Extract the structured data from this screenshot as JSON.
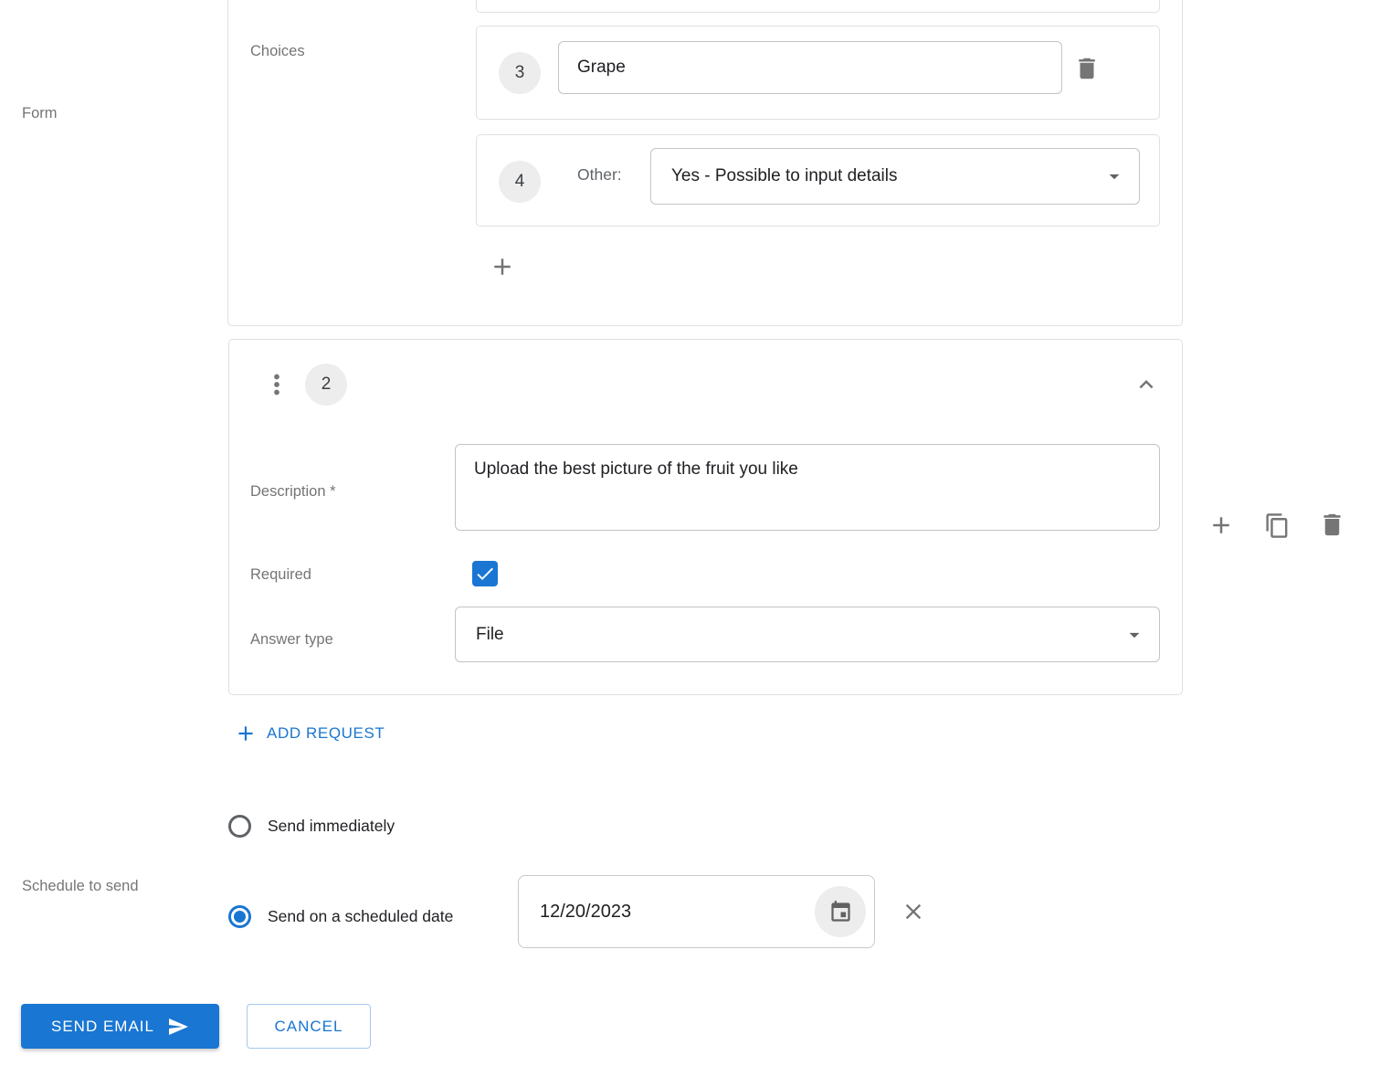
{
  "labels": {
    "form": "Form",
    "schedule_to_send": "Schedule to send"
  },
  "choices_card": {
    "section_label": "Choices",
    "choice3": {
      "number": "3",
      "value": "Grape"
    },
    "choice4": {
      "number": "4",
      "other_label": "Other:",
      "value": "Yes - Possible to input details"
    }
  },
  "request_card": {
    "number": "2",
    "description_label": "Description *",
    "description_value": "Upload the best picture of the fruit you like",
    "required_label": "Required",
    "required_checked": true,
    "answer_type_label": "Answer type",
    "answer_type_value": "File"
  },
  "actions": {
    "add_request_label": "ADD REQUEST"
  },
  "schedule": {
    "send_immediately": {
      "label": "Send immediately",
      "selected": false
    },
    "scheduled": {
      "label": "Send on a scheduled date",
      "selected": true,
      "date_value": "12/20/2023"
    }
  },
  "footer": {
    "send_email_label": "SEND EMAIL",
    "cancel_label": "CANCEL"
  },
  "colors": {
    "primary": "#1976d2",
    "icon_gray": "#757575",
    "card_border": "#e0e0e0",
    "input_border": "#c4c4c4",
    "badge_bg": "#ededed"
  },
  "icons": {
    "drag_handle": "more-vert-dots",
    "collapse": "chevron-up",
    "delete": "trash",
    "duplicate": "copy",
    "add": "plus",
    "dropdown": "caret-down",
    "calendar": "calendar",
    "clear": "x-close",
    "send": "paper-plane"
  }
}
